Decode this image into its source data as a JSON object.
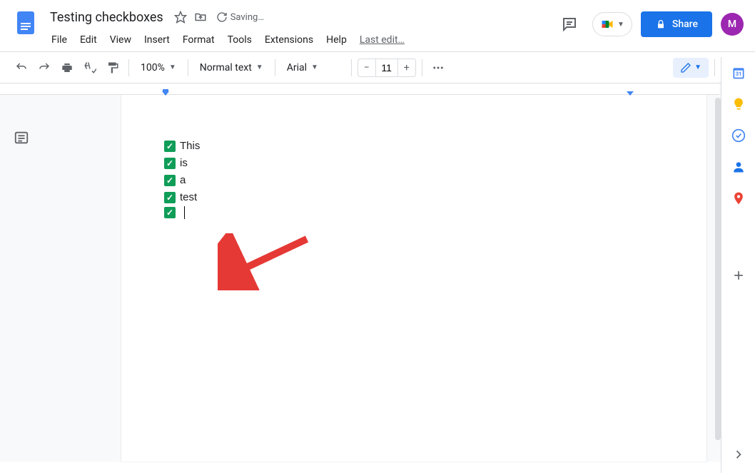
{
  "header": {
    "title": "Testing checkboxes",
    "saving_label": "Saving…",
    "last_edit_label": "Last edit…",
    "share_label": "Share",
    "avatar_initial": "M"
  },
  "menus": [
    "File",
    "Edit",
    "View",
    "Insert",
    "Format",
    "Tools",
    "Extensions",
    "Help"
  ],
  "toolbar": {
    "zoom": "100%",
    "style": "Normal text",
    "font": "Arial",
    "font_size": "11"
  },
  "document": {
    "checklist_items": [
      {
        "text": "This",
        "checked": true
      },
      {
        "text": "is",
        "checked": true
      },
      {
        "text": "a",
        "checked": true
      },
      {
        "text": "test",
        "checked": true
      },
      {
        "text": "",
        "checked": true
      }
    ]
  }
}
